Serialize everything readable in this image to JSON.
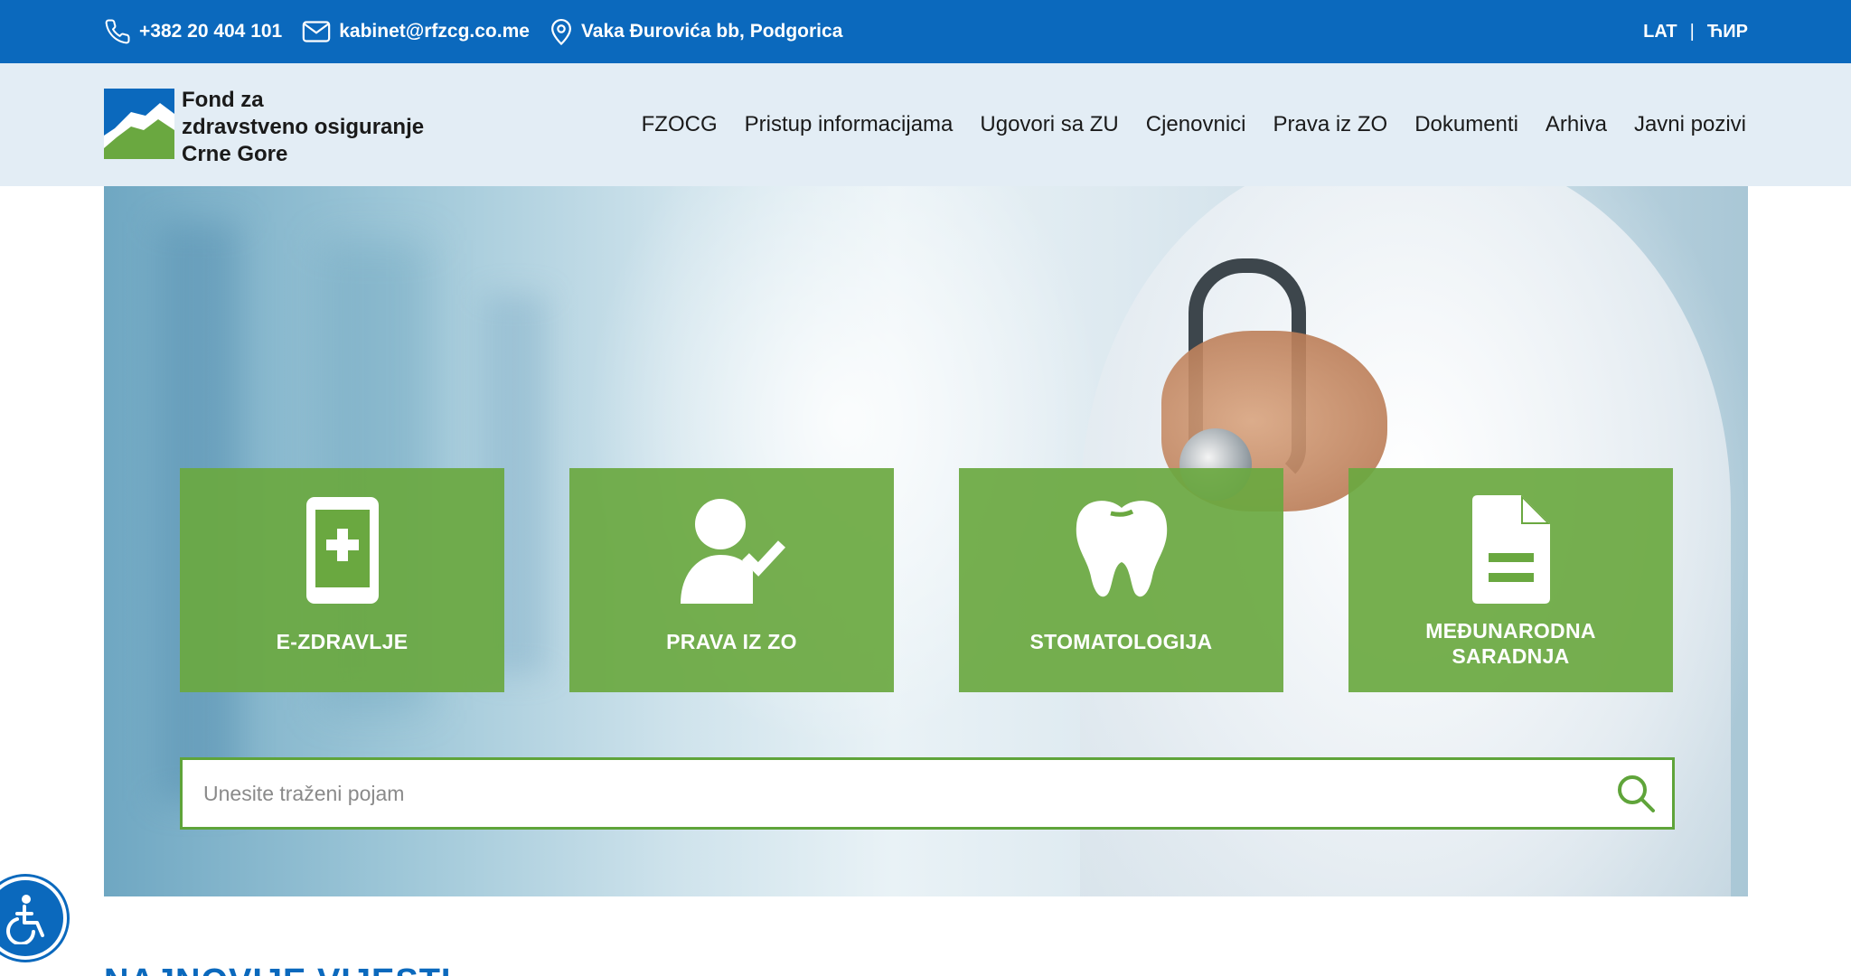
{
  "topbar": {
    "phone": "+382 20 404 101",
    "email": "kabinet@rfzcg.co.me",
    "address": "Vaka Đurovića bb, Podgorica",
    "lang_lat": "LAT",
    "lang_sep": "|",
    "lang_cyr": "ЋИР"
  },
  "logo": {
    "line1": "Fond za",
    "line2": "zdravstveno osiguranje",
    "line3": "Crne Gore"
  },
  "nav": {
    "items": [
      "FZOCG",
      "Pristup informacijama",
      "Ugovori sa ZU",
      "Cjenovnici",
      "Prava iz ZO",
      "Dokumenti",
      "Arhiva",
      "Javni pozivi"
    ]
  },
  "tiles": [
    {
      "label": "E-ZDRAVLJE",
      "icon": "mobile-plus-icon"
    },
    {
      "label": "PRAVA IZ ZO",
      "icon": "user-check-icon"
    },
    {
      "label": "STOMATOLOGIJA",
      "icon": "tooth-icon"
    },
    {
      "label_line1": "MEĐUNARODNA",
      "label_line2": "SARADNJA",
      "icon": "document-icon"
    }
  ],
  "search": {
    "placeholder": "Unesite traženi pojam",
    "icon": "search-icon"
  },
  "section": {
    "title": "NAJNOVIJE VIJESTI"
  },
  "colors": {
    "primary_blue": "#0b69bd",
    "header_bg": "#e3edf5",
    "tile_green": "#6aa840",
    "search_border": "#5fa43a"
  }
}
